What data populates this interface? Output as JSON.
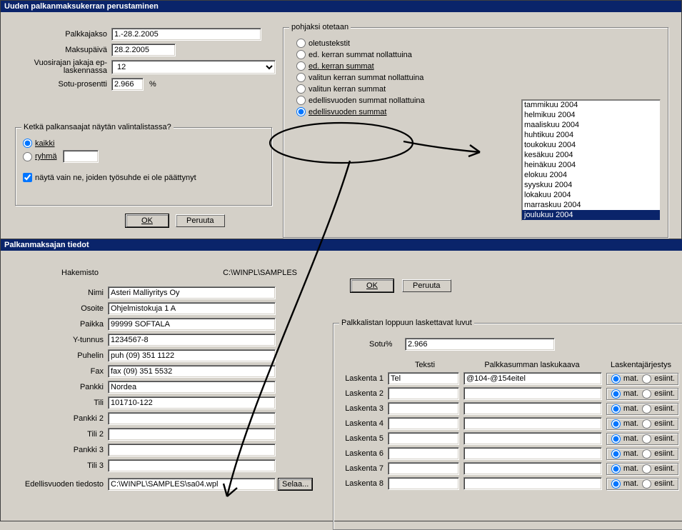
{
  "window1": {
    "title": "Uuden palkanmaksukerran perustaminen",
    "labels": {
      "palkkajakso": "Palkkajakso",
      "maksupaiva": "Maksupäivä",
      "vuosirajan": "Vuosirajan jakaja ep-laskennassa",
      "sotu": "Sotu-prosentti",
      "percent": "%"
    },
    "values": {
      "palkkajakso": "1.-28.2.2005",
      "maksupaiva": "28.2.2005",
      "vuosirajan": "12",
      "sotu": "2.966"
    },
    "group_who": {
      "title": "Ketkä palkansaajat näytän valintalistassa?",
      "radio_kaikki": "kaikki",
      "radio_ryhma": "ryhmä",
      "check_naytavain": "näytä vain ne, joiden työsuhde ei ole päättynyt"
    },
    "group_pohjaksi": {
      "title": "pohjaksi otetaan",
      "options": [
        "oletustekstit",
        "ed. kerran summat nollattuina",
        "ed. kerran summat",
        "valitun kerran summat nollattuina",
        "valitun kerran summat",
        "edellisvuoden summat nollattuina",
        "edellisvuoden summat"
      ]
    },
    "listbox": {
      "items": [
        "tammikuu 2004",
        "helmikuu 2004",
        "maaliskuu 2004",
        "huhtikuu 2004",
        "toukokuu 2004",
        "kesäkuu 2004",
        "heinäkuu 2004",
        "elokuu 2004",
        "syyskuu 2004",
        "lokakuu 2004",
        "marraskuu 2004",
        "joulukuu 2004"
      ],
      "selected": 11
    },
    "buttons": {
      "ok": "OK",
      "cancel": "Peruuta"
    }
  },
  "window2": {
    "title": "Palkanmaksajan tiedot",
    "hakemisto_label": "Hakemisto",
    "hakemisto_value": "C:\\WINPL\\SAMPLES",
    "fields": {
      "nimi": "Nimi",
      "nimi_v": "Asteri Malliyritys Oy",
      "osoite": "Osoite",
      "osoite_v": "Ohjelmistokuja 1 A",
      "paikka": "Paikka",
      "paikka_v": "99999 SOFTALA",
      "ytunnus": "Y-tunnus",
      "ytunnus_v": "1234567-8",
      "puhelin": "Puhelin",
      "puhelin_v": "puh (09) 351 1122",
      "fax": "Fax",
      "fax_v": "fax (09) 351 5532",
      "pankki": "Pankki",
      "pankki_v": "Nordea",
      "tili": "Tili",
      "tili_v": "101710-122",
      "pankki2": "Pankki 2",
      "pankki2_v": "",
      "tili2": "Tili 2",
      "tili2_v": "",
      "pankki3": "Pankki 3",
      "pankki3_v": "",
      "tili3": "Tili 3",
      "tili3_v": "",
      "edellis": "Edellisvuoden tiedosto",
      "edellis_v": "C:\\WINPL\\SAMPLES\\sa04.wpl",
      "selaa": "Selaa..."
    },
    "buttons": {
      "ok": "OK",
      "cancel": "Peruuta"
    },
    "group_palkkalista": {
      "title": "Palkkalistan loppuun laskettavat luvut",
      "sotu_label": "Sotu%",
      "sotu_value": "2.966",
      "col_teksti": "Teksti",
      "col_kaava": "Palkkasumman laskukaava",
      "col_jarj": "Laskentajärjestys",
      "rows": [
        {
          "label": "Laskenta 1",
          "teksti": "Tel",
          "kaava": "@104-@154eitel"
        },
        {
          "label": "Laskenta 2",
          "teksti": "",
          "kaava": ""
        },
        {
          "label": "Laskenta 3",
          "teksti": "",
          "kaava": ""
        },
        {
          "label": "Laskenta 4",
          "teksti": "",
          "kaava": ""
        },
        {
          "label": "Laskenta 5",
          "teksti": "",
          "kaava": ""
        },
        {
          "label": "Laskenta 6",
          "teksti": "",
          "kaava": ""
        },
        {
          "label": "Laskenta 7",
          "teksti": "",
          "kaava": ""
        },
        {
          "label": "Laskenta 8",
          "teksti": "",
          "kaava": ""
        }
      ],
      "radio_mat": "mat.",
      "radio_esiint": "esiint."
    }
  }
}
